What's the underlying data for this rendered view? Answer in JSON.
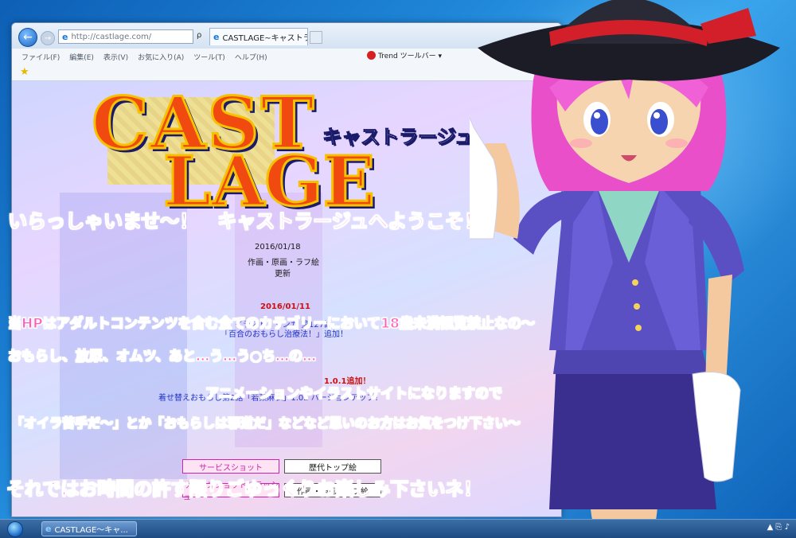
{
  "browser": {
    "address_text": "http://castlage.com/",
    "address_tools": "ρ • ✕",
    "tab_title": "CASTLAGE~キャストラ...",
    "menu_items": [
      "ファイル(F)",
      "編集(E)",
      "表示(V)",
      "お気に入り(A)",
      "ツール(T)",
      "ヘルプ(H)"
    ],
    "toolbar_text": "Trend ツールバー ▾"
  },
  "site": {
    "logo_line1": "CAST",
    "logo_line2": "LAGE",
    "logo_kana": "キャストラージュ",
    "news_date1_fragment": "2016/01/18",
    "news_update1_line1": "作画・原画・ラフ絵",
    "news_update1_line2": "更新",
    "news_date2": "2016/01/11",
    "news_update2_line1": "イラスト・マンガ 第127話",
    "news_update2_line2": "「百合のおもらし治療法！」追加！",
    "news_version": "1.0.1追加！",
    "news_update3": "着せ替えおもらし第2話「若菜麻衣」1.02 バージョンアップ！",
    "btn_service_shot": "サービスショット",
    "btn_history_top": "歴代トップ絵",
    "btn_service_flash": "サービスショットフラッシュ",
    "btn_artwork": "作画・原画・ラフ絵"
  },
  "overlay": {
    "welcome": "いらっしゃいませ〜！　キャストラージュへようこそ！",
    "line1": "当HPはアダルトコンテンツを含む全てのカテゴリーにおいて18歳未満観覧禁止なの〜",
    "line2": "おもらし、放尿、オムツ、あと…う…う○ち…の…",
    "line3": "アニメーションやイラストサイトになりますので",
    "line4": "「オイラ苦手だ〜」とか「おもらしは邪道だ」などなど思いのお方はお気をつけ下さい〜",
    "closing": "それではお時間の許す限りごゆっくりお楽しみ下さいネ！"
  },
  "taskbar": {
    "task_label": "CASTLAGE～キャ...",
    "tray_icons": "▲  ⎘  ♪"
  },
  "colors": {
    "overlay_pink": "#ff5fb7",
    "logo_orange": "#f04a10",
    "logo_outline": "#f7c100"
  }
}
